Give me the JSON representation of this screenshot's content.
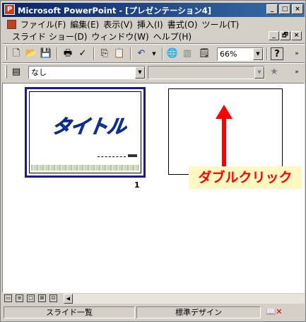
{
  "window": {
    "title": "Microsoft PowerPoint - [プレゼンテーション4]",
    "buttons": [
      "_",
      "□",
      "×"
    ]
  },
  "menu": {
    "row1": [
      "ファイル(F)",
      "編集(E)",
      "表示(V)",
      "挿入(I)",
      "書式(O)",
      "ツール(T)"
    ],
    "row2": [
      "スライド ショー(D)",
      "ウィンドウ(W)",
      "ヘルプ(H)"
    ],
    "doc_buttons": [
      "_",
      "🗗",
      "×"
    ]
  },
  "toolbar": {
    "zoom": "66%",
    "help_glyph": "?"
  },
  "formatting": {
    "font": "なし",
    "size": ""
  },
  "slides": [
    {
      "number": "1",
      "title": "タイトル"
    },
    {
      "number": ""
    }
  ],
  "annotation": {
    "text": "ダブルクリック",
    "color": "#ff0000",
    "background": "#fff8c0"
  },
  "status": {
    "view": "スライド一覧",
    "design": "標準デザイン"
  }
}
